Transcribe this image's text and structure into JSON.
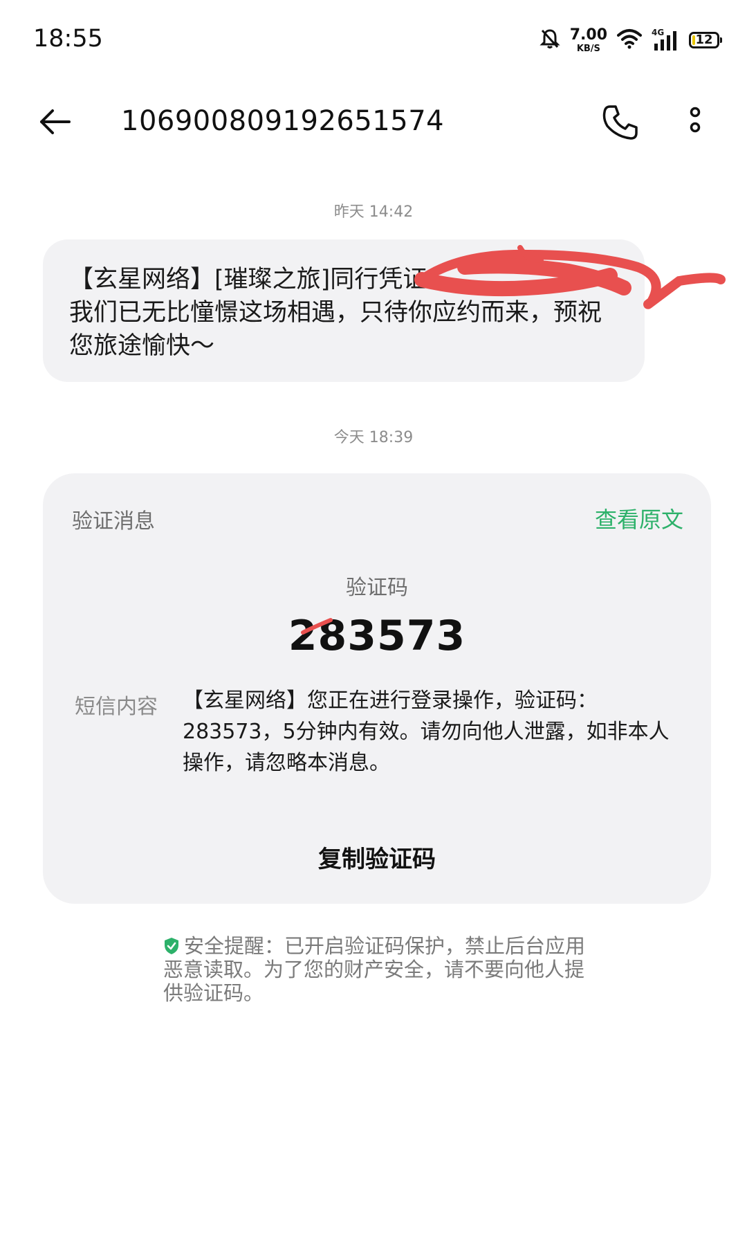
{
  "status_bar": {
    "time": "18:55",
    "net_speed_value": "7.00",
    "net_speed_unit": "KB/S",
    "network_type": "4G",
    "battery_level": "12",
    "icons": [
      "bell-muted-icon",
      "wifi-icon",
      "cellular-signal-icon",
      "battery-icon"
    ]
  },
  "header": {
    "title": "106900809192651574",
    "icons": [
      "back-arrow-icon",
      "phone-icon",
      "more-vertical-icon"
    ]
  },
  "messages": [
    {
      "timestamp": "昨天 14:42",
      "text": "【玄星网络】[璀璨之旅]同行凭证\n我们已无比憧憬这场相遇，只待你应约而来，预祝您旅途愉快～"
    }
  ],
  "verification_card": {
    "timestamp": "今天 18:39",
    "label": "验证消息",
    "view_original": "查看原文",
    "code_title": "验证码",
    "code": "283573",
    "sms_label": "短信内容",
    "sms_content": "【玄星网络】您正在进行登录操作，验证码：283573，5分钟内有效。请勿向他人泄露，如非本人操作，请忽略本消息。",
    "copy_button": "复制验证码"
  },
  "security_note": {
    "text": "安全提醒：已开启验证码保护，禁止后台应用恶意读取。为了您的财产安全，请不要向他人提供验证码。",
    "icon": "shield-check-icon"
  },
  "colors": {
    "accent_green": "#2db16a",
    "bubble_bg": "#f2f2f4",
    "redaction": "#e8504f"
  }
}
